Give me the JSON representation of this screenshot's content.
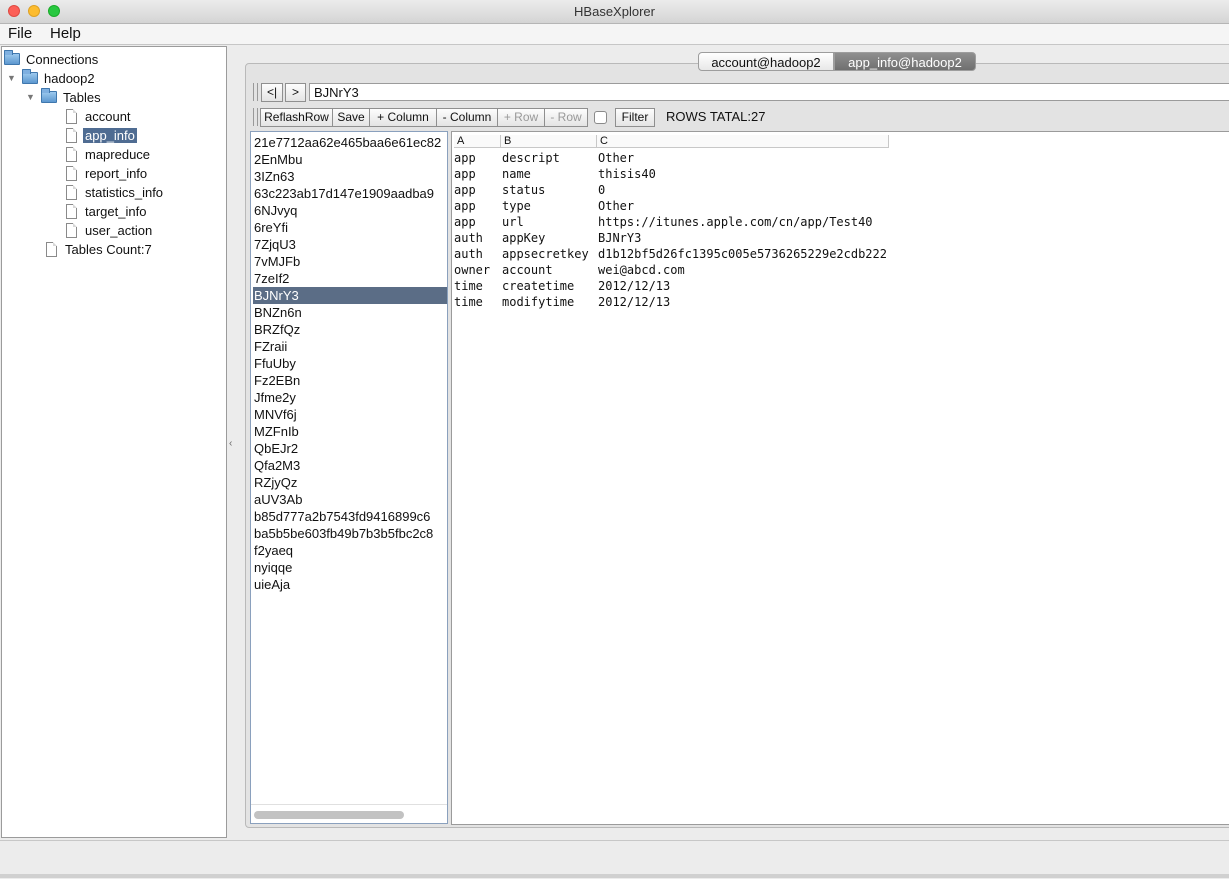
{
  "window": {
    "title": "HBaseXplorer"
  },
  "menu": [
    "File",
    "Help"
  ],
  "tree": {
    "root": "Connections",
    "connection": "hadoop2",
    "tables_folder": "Tables",
    "tables": [
      "account",
      "app_info",
      "mapreduce",
      "report_info",
      "statistics_info",
      "target_info",
      "user_action"
    ],
    "selected_table": "app_info",
    "tables_count": "Tables Count:7"
  },
  "tabs": [
    {
      "label": "account@hadoop2",
      "active": false
    },
    {
      "label": "app_info@hadoop2",
      "active": true
    }
  ],
  "nav": {
    "first_label": "<|",
    "next_label": ">",
    "rowkey_value": "BJNrY3"
  },
  "toolbar": {
    "reflash_row": "ReflashRow",
    "save": "Save",
    "add_column": "+ Column",
    "remove_column": "- Column",
    "add_row": "+ Row",
    "remove_row": "- Row",
    "filter": "Filter",
    "rows_total": "ROWS TATAL:27"
  },
  "rows": [
    "21e7712aa62e465baa6e61ec82",
    "2EnMbu",
    "3IZn63",
    "63c223ab17d147e1909aadba9",
    "6NJvyq",
    "6reYfi",
    "7ZjqU3",
    "7vMJFb",
    "7zeIf2",
    "BJNrY3",
    "BNZn6n",
    "BRZfQz",
    "FZraii",
    "FfuUby",
    "Fz2EBn",
    "Jfme2y",
    "MNVf6j",
    "MZFnIb",
    "QbEJr2",
    "Qfa2M3",
    "RZjyQz",
    "aUV3Ab",
    "b85d777a2b7543fd9416899c6",
    "ba5b5be603fb49b7b3b5fbc2c8",
    "f2yaeq",
    "nyiqqe",
    "uieAja"
  ],
  "selected_row": "BJNrY3",
  "detail": {
    "columns": [
      "A",
      "B",
      "C"
    ],
    "cells": [
      [
        "app",
        "descript",
        "Other"
      ],
      [
        "app",
        "name",
        "thisis40"
      ],
      [
        "app",
        "status",
        "0"
      ],
      [
        "app",
        "type",
        "Other"
      ],
      [
        "app",
        "url",
        "https://itunes.apple.com/cn/app/Test40"
      ],
      [
        "auth",
        "appKey",
        "BJNrY3"
      ],
      [
        "auth",
        "appsecretkey",
        "d1b12bf5d26fc1395c005e5736265229e2cdb222"
      ],
      [
        "owner",
        "account",
        "wei@abcd.com"
      ],
      [
        "time",
        "createtime",
        "2012/12/13"
      ],
      [
        "time",
        "modifytime",
        "2012/12/13"
      ]
    ]
  }
}
